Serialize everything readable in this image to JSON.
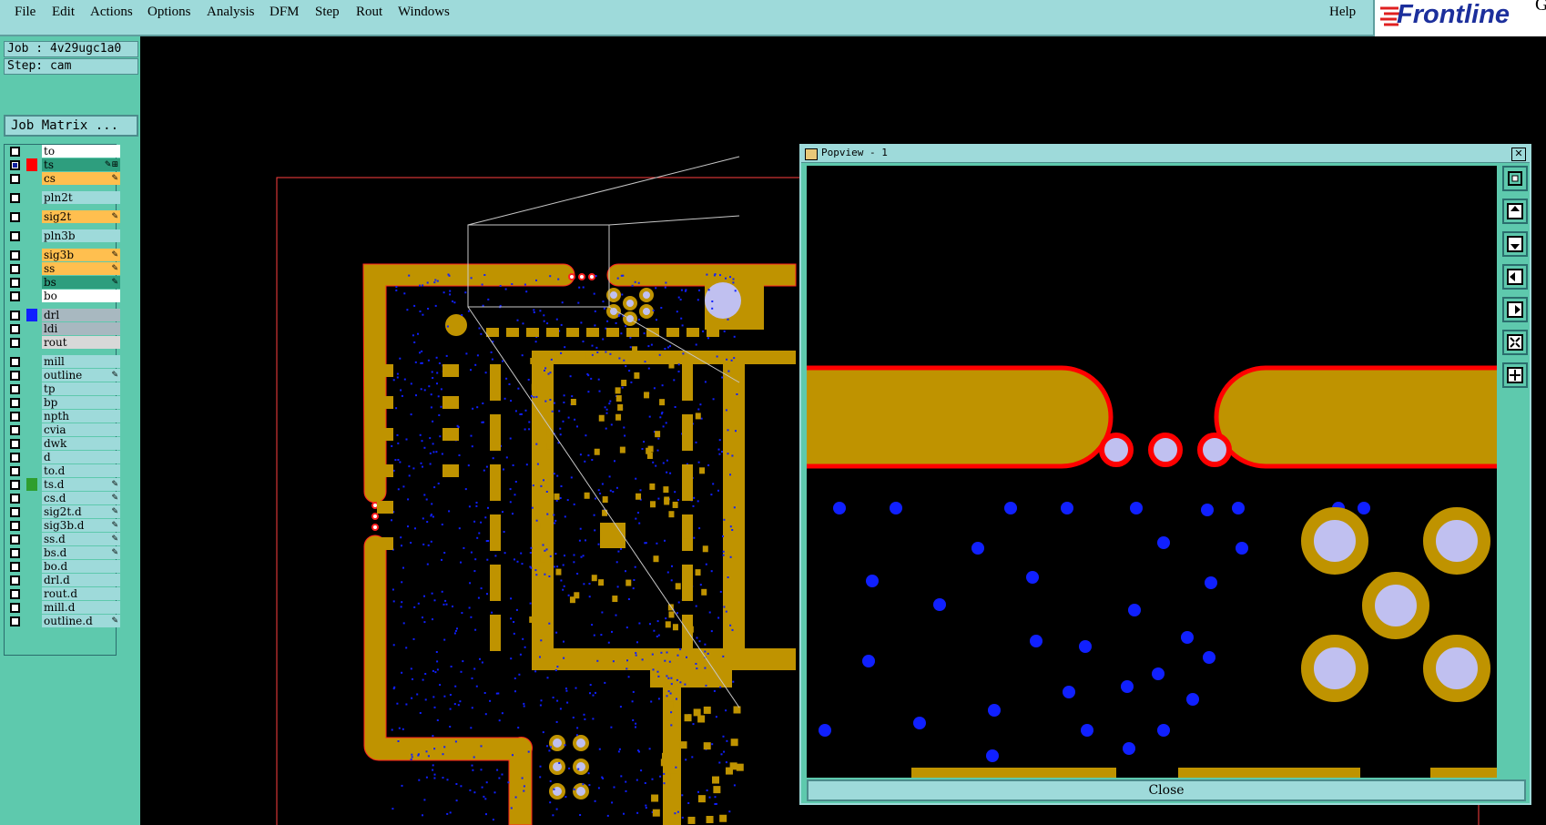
{
  "menu": {
    "items": [
      "File",
      "Edit",
      "Actions",
      "Options",
      "Analysis",
      "DFM",
      "Step",
      "Rout",
      "Windows"
    ],
    "help": "Help"
  },
  "logo": {
    "text": "Frontline",
    "suffix": "G"
  },
  "job": {
    "job_label": "Job : 4v29ugc1a0",
    "step_label": "Step: cam",
    "matrix_button": "Job Matrix ..."
  },
  "layers": [
    {
      "name": "to",
      "color": "#ffffff",
      "swatch": "",
      "flag": ""
    },
    {
      "name": "ts",
      "color": "#2e9e7e",
      "swatch": "#ff0000",
      "flag": "✎⊞",
      "selected": true
    },
    {
      "name": "cs",
      "color": "#ffbf4f",
      "swatch": "",
      "flag": "✎"
    },
    {
      "name": "pln2t",
      "color": "#9edada",
      "swatch": "",
      "flag": ""
    },
    {
      "name": "sig2t",
      "color": "#ffbf4f",
      "swatch": "",
      "flag": "✎"
    },
    {
      "name": "pln3b",
      "color": "#9edada",
      "swatch": "",
      "flag": ""
    },
    {
      "name": "sig3b",
      "color": "#ffbf4f",
      "swatch": "",
      "flag": "✎"
    },
    {
      "name": "ss",
      "color": "#ffbf4f",
      "swatch": "",
      "flag": "✎"
    },
    {
      "name": "bs",
      "color": "#2e9e7e",
      "swatch": "",
      "flag": "✎"
    },
    {
      "name": "bo",
      "color": "#ffffff",
      "swatch": "",
      "flag": ""
    },
    {
      "name": "drl",
      "color": "#a8b8c0",
      "swatch": "#1020ff",
      "flag": ""
    },
    {
      "name": "ldi",
      "color": "#a8b8c0",
      "swatch": "",
      "flag": ""
    },
    {
      "name": "rout",
      "color": "#d8d8d8",
      "swatch": "",
      "flag": ""
    },
    {
      "name": "mill",
      "color": "#9edada",
      "swatch": "",
      "flag": ""
    },
    {
      "name": "outline",
      "color": "#9edada",
      "swatch": "",
      "flag": "✎"
    },
    {
      "name": "tp",
      "color": "#9edada",
      "swatch": "",
      "flag": ""
    },
    {
      "name": "bp",
      "color": "#9edada",
      "swatch": "",
      "flag": ""
    },
    {
      "name": "npth",
      "color": "#9edada",
      "swatch": "",
      "flag": ""
    },
    {
      "name": "cvia",
      "color": "#9edada",
      "swatch": "",
      "flag": ""
    },
    {
      "name": "dwk",
      "color": "#9edada",
      "swatch": "",
      "flag": ""
    },
    {
      "name": "d",
      "color": "#9edada",
      "swatch": "",
      "flag": ""
    },
    {
      "name": "to.d",
      "color": "#9edada",
      "swatch": "",
      "flag": ""
    },
    {
      "name": "ts.d",
      "color": "#9edada",
      "swatch": "#2e9e2e",
      "flag": "✎"
    },
    {
      "name": "cs.d",
      "color": "#9edada",
      "swatch": "",
      "flag": "✎"
    },
    {
      "name": "sig2t.d",
      "color": "#9edada",
      "swatch": "",
      "flag": "✎"
    },
    {
      "name": "sig3b.d",
      "color": "#9edada",
      "swatch": "",
      "flag": "✎"
    },
    {
      "name": "ss.d",
      "color": "#9edada",
      "swatch": "",
      "flag": "✎"
    },
    {
      "name": "bs.d",
      "color": "#9edada",
      "swatch": "",
      "flag": "✎"
    },
    {
      "name": "bo.d",
      "color": "#9edada",
      "swatch": "",
      "flag": ""
    },
    {
      "name": "drl.d",
      "color": "#9edada",
      "swatch": "",
      "flag": ""
    },
    {
      "name": "rout.d",
      "color": "#9edada",
      "swatch": "",
      "flag": ""
    },
    {
      "name": "mill.d",
      "color": "#9edada",
      "swatch": "",
      "flag": ""
    },
    {
      "name": "outline.d",
      "color": "#9edada",
      "swatch": "",
      "flag": "✎"
    }
  ],
  "popview": {
    "title": "Popview - 1",
    "close_label": "Close"
  },
  "colors": {
    "copper": "#bf9300",
    "pad_hole": "#c0c0f0",
    "via": "#1020ff",
    "outline": "#ff0000",
    "panel": "#5ec9ad",
    "menu": "#9edada"
  },
  "icons": [
    "window-icon",
    "zoom-in-icon",
    "pan-up-icon",
    "pan-down-icon",
    "pan-left-icon",
    "pan-right-icon",
    "zoom-fit-icon",
    "zoom-home-icon"
  ]
}
